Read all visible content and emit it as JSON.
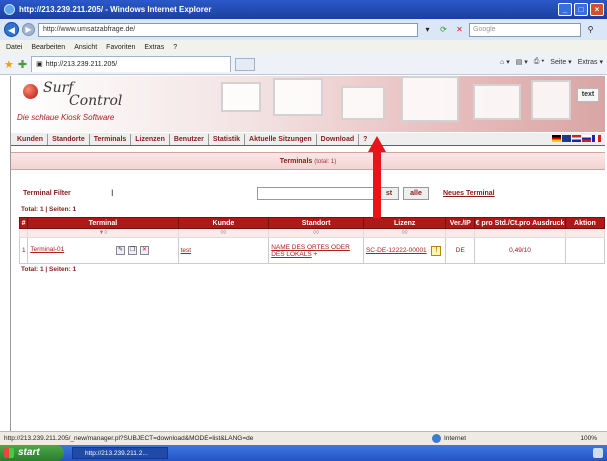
{
  "window": {
    "title": "http://213.239.211.205/ - Windows Internet Explorer",
    "buttons": [
      "_",
      "□",
      "×"
    ]
  },
  "addressbar": {
    "url": "http://www.umsatzabfrage.de/",
    "search_placeholder": "Google"
  },
  "menubar": [
    "Datei",
    "Bearbeiten",
    "Ansicht",
    "Favoriten",
    "Extras",
    "?"
  ],
  "tab": {
    "title": "http://213.239.211.205/",
    "tools": [
      "Seite ▾",
      "Extras ▾"
    ]
  },
  "banner": {
    "logo_line1": "Surf",
    "logo_line2": "Control",
    "tagline": "Die schlaue Kiosk Software",
    "text_button": "text"
  },
  "nav": [
    "Kunden",
    "Standorte",
    "Terminals",
    "Lizenzen",
    "Benutzer",
    "Statistik",
    "Aktuelle Sitzungen",
    "Download",
    "?"
  ],
  "section": {
    "title": "Terminals",
    "subtitle": "(total: 1)"
  },
  "filter": {
    "label": "Terminal Filter",
    "cursor": "I",
    "search_button": "st",
    "clear_button": "alle",
    "new_link": "Neues Terminal"
  },
  "total": "Total: 1 | Seiten: 1",
  "table": {
    "headers": [
      "#",
      "Terminal",
      "Kunde",
      "Standort",
      "Lizenz",
      "Ver./IP",
      "€ pro Std./Ct.pro Ausdruck",
      "Aktion"
    ],
    "sort_glyphs": [
      "▼◊",
      "◊◊",
      "◊◊",
      "◊◊"
    ],
    "rows": [
      {
        "num": "1",
        "terminal": "Terminal-01",
        "kunde": "test",
        "standort": "NAME DES ORTES ODER DES LOKALS",
        "standort_suffix": "+",
        "lizenz": "SC-DE-12222-00001",
        "ver_ip": "DE",
        "preis": "0,49/10",
        "aktion": ""
      }
    ]
  },
  "statusbar": {
    "url": "http://213.239.211.205/_new/manager.pl?SUBJECT=download&MODE=list&LANG=de",
    "zone": "Internet",
    "zoom": "100%"
  },
  "taskbar": {
    "start_label": "start",
    "task_label": "http://213.239.211.2..."
  },
  "colors": {
    "accent": "#b01818",
    "link": "#a22222",
    "arrow": "#e8141c"
  }
}
